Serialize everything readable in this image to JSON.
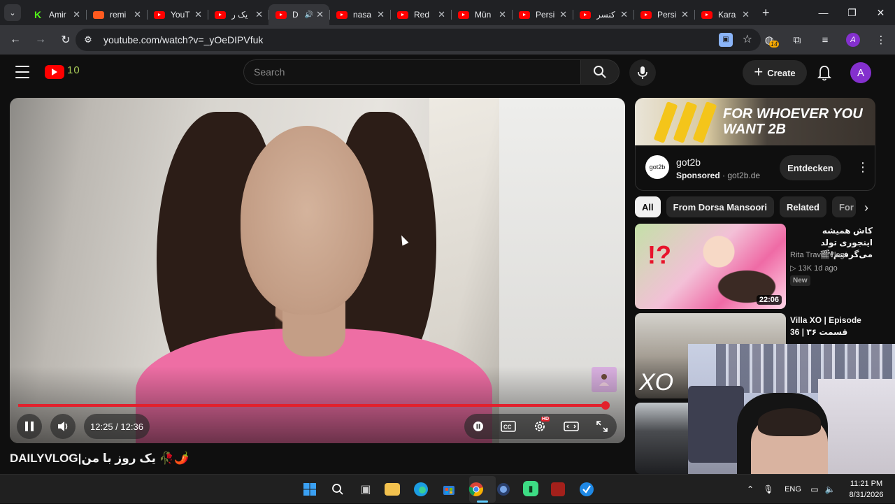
{
  "browser": {
    "tabs": [
      {
        "title": "Amir",
        "favicon": "kick-icon",
        "active": false
      },
      {
        "title": "remi",
        "favicon": "remix-icon",
        "active": false
      },
      {
        "title": "YouT",
        "favicon": "youtube-icon",
        "active": false
      },
      {
        "title": "یک ر",
        "favicon": "youtube-icon",
        "active": false
      },
      {
        "title": "D",
        "favicon": "youtube-icon",
        "active": true
      },
      {
        "title": "nasa",
        "favicon": "youtube-icon",
        "active": false
      },
      {
        "title": "Red",
        "favicon": "youtube-icon",
        "active": false
      },
      {
        "title": "Mün",
        "favicon": "youtube-icon",
        "active": false
      },
      {
        "title": "Persi",
        "favicon": "youtube-icon",
        "active": false
      },
      {
        "title": "کنسر",
        "favicon": "youtube-icon",
        "active": false
      },
      {
        "title": "Persi",
        "favicon": "youtube-icon",
        "active": false
      },
      {
        "title": "Kara",
        "favicon": "youtube-icon",
        "active": false
      }
    ],
    "url": "youtube.com/watch?v=_yOeDIPVfuk",
    "extensions_badge": "14",
    "profile_initial": "A"
  },
  "youtube": {
    "search_placeholder": "Search",
    "create_label": "Create",
    "avatar_initial": "A",
    "logo_doodle": "10",
    "player": {
      "time_display": "12:25 / 12:36",
      "progress_fraction": 0.986,
      "hd_badge": "HD"
    },
    "video_title": "DAILYVLOG|یک روز با من 🥀🌶️"
  },
  "sidebar": {
    "ad": {
      "headline": "FOR WHOEVER YOU WANT 2B",
      "brand": "got2b",
      "logo_text": "got2b",
      "sponsored_label": "Sponsored",
      "domain": "got2b.de",
      "cta": "Entdecken"
    },
    "chips": [
      "All",
      "From Dorsa Mansoori",
      "Related",
      "For"
    ],
    "recommendations": [
      {
        "title": "کاش همیشه اینجوری تولد می‌گرفتم!🎬",
        "channel": "Rita Travel Vlog",
        "meta": "13K  1d ago",
        "badge": "New",
        "duration": "22:06",
        "thumb_text": "!?"
      },
      {
        "title": "Villa XO | Episode 36 | قسمت ۳۶",
        "channel": "",
        "meta": "",
        "badge": "",
        "duration": "",
        "thumb_text": "XO"
      }
    ]
  },
  "taskbar": {
    "language": "ENG",
    "time": "11:21 PM",
    "date": "8/31/2026"
  }
}
